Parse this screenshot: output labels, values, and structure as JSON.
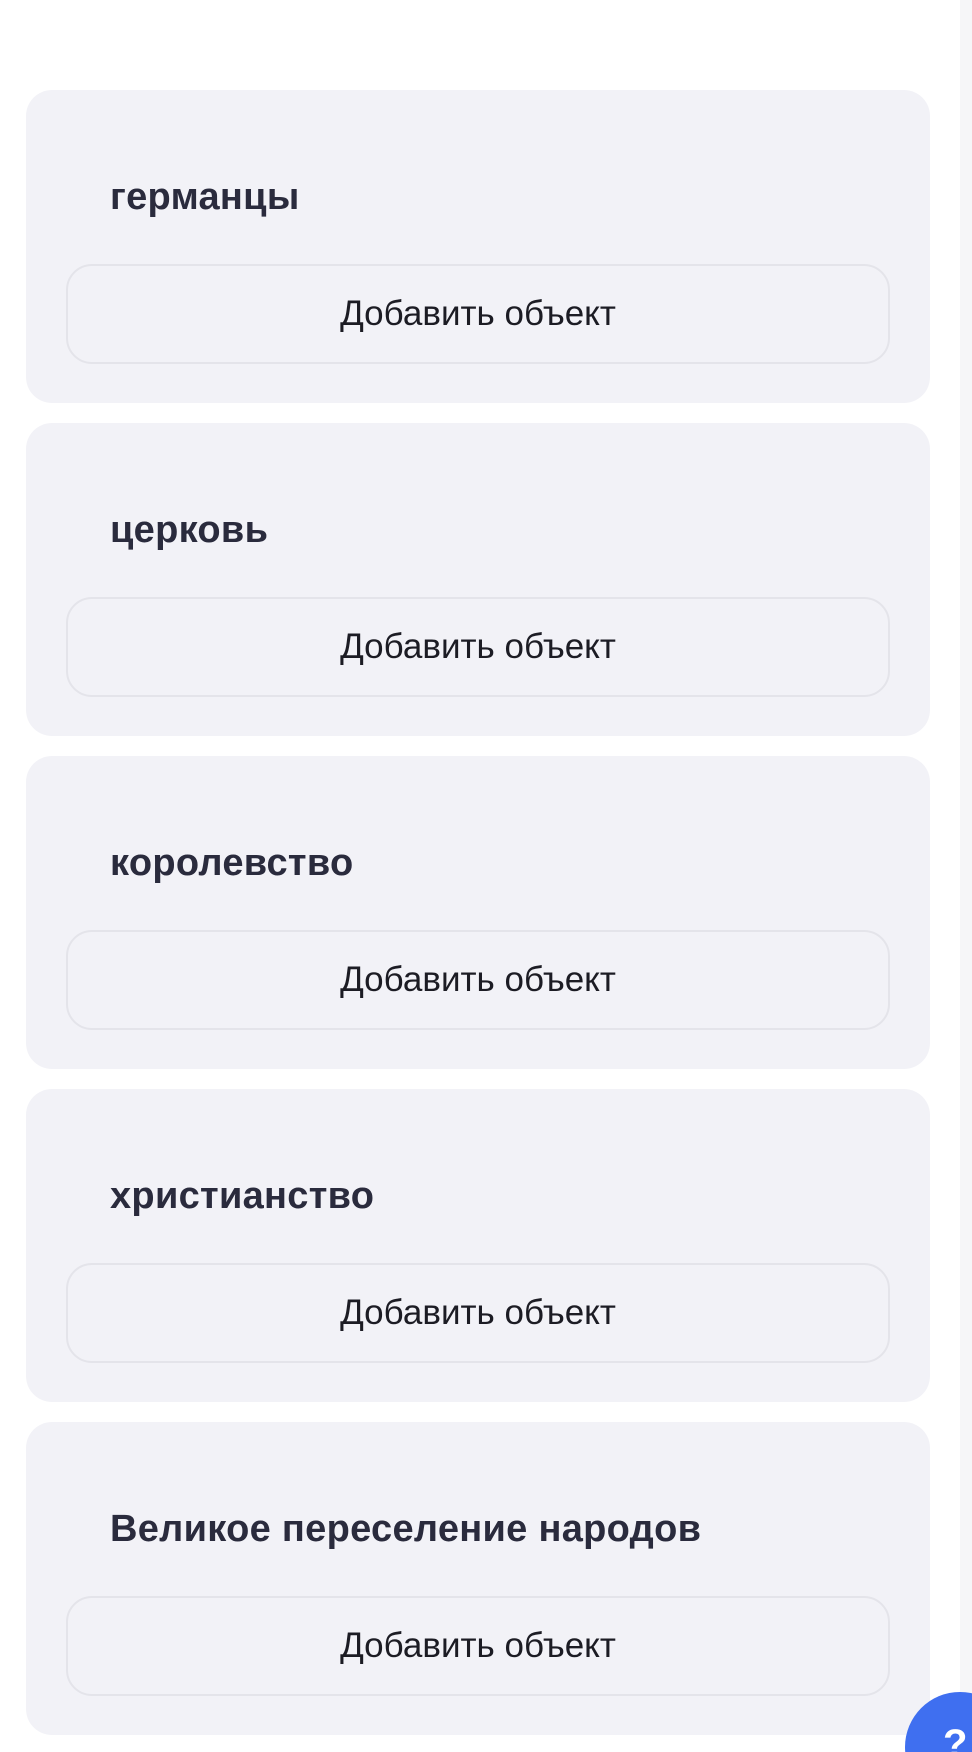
{
  "cards": [
    {
      "title": "германцы",
      "button_label": "Добавить объект"
    },
    {
      "title": "церковь",
      "button_label": "Добавить объект"
    },
    {
      "title": "королевство",
      "button_label": "Добавить объект"
    },
    {
      "title": "христианство",
      "button_label": "Добавить объект"
    },
    {
      "title": "Великое переселение народов",
      "button_label": "Добавить объект"
    }
  ],
  "help_button": {
    "label": "?"
  },
  "colors": {
    "card_background": "#f2f2f7",
    "title_text": "#2a2b3d",
    "button_border": "#e4e4ea",
    "accent": "#3f6ff0"
  }
}
